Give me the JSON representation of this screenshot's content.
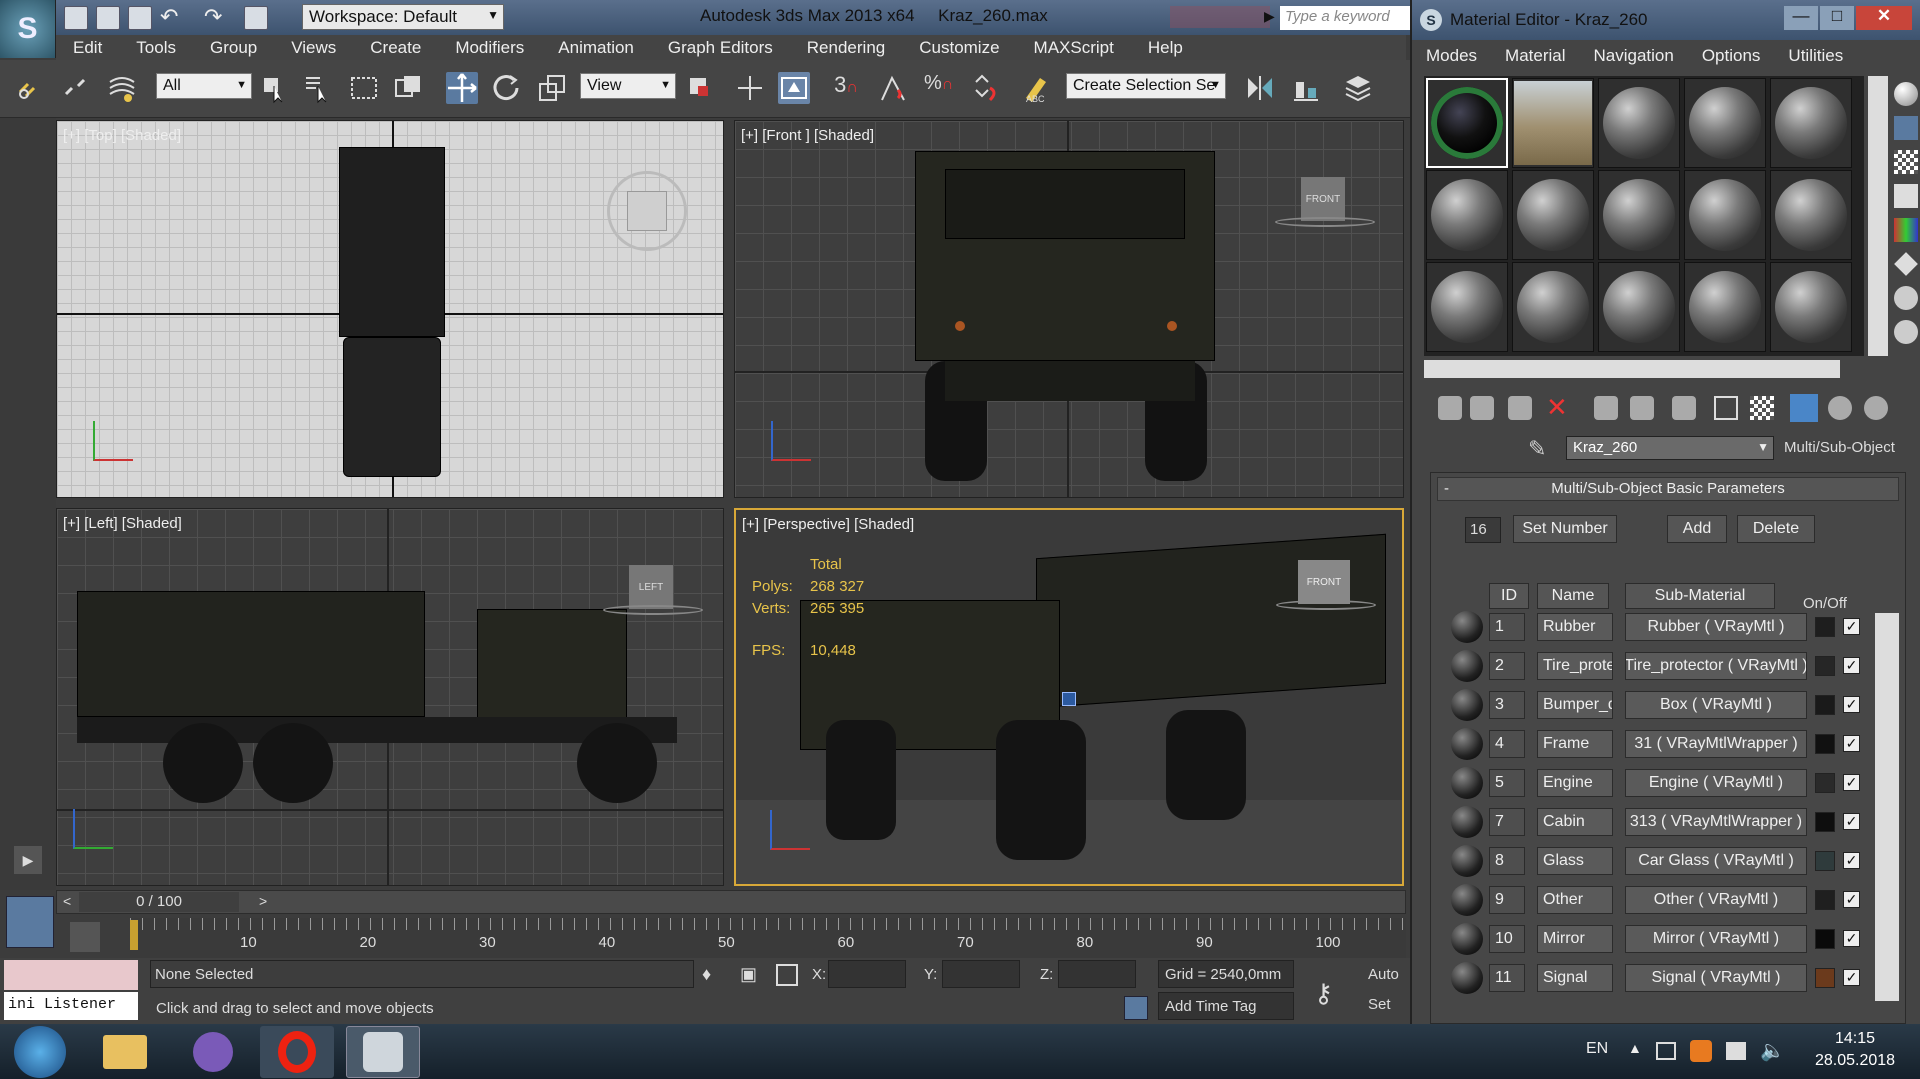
{
  "app": {
    "title": "Autodesk 3ds Max  2013 x64",
    "file": "Kraz_260.max",
    "logo": "S",
    "workspace": "Workspace: Default",
    "search_placeholder": "Type a keyword"
  },
  "menu": [
    "Edit",
    "Tools",
    "Group",
    "Views",
    "Create",
    "Modifiers",
    "Animation",
    "Graph Editors",
    "Rendering",
    "Customize",
    "MAXScript",
    "Help"
  ],
  "toolbar": {
    "filter": "All",
    "refcoord": "View",
    "selection_set": "Create Selection Se",
    "snap_toggle": "3"
  },
  "viewports": {
    "top": {
      "label": "[+] [Top] [Shaded]"
    },
    "front": {
      "label": "[+] [Front ] [Shaded]",
      "viewcube": "FRONT"
    },
    "left": {
      "label": "[+] [Left] [Shaded]",
      "viewcube": "LEFT"
    },
    "perspective": {
      "label": "[+] [Perspective] [Shaded]",
      "viewcube": "FRONT",
      "stats_title": "Total",
      "polys_label": "Polys:",
      "polys_value": "268 327",
      "verts_label": "Verts:",
      "verts_value": "265 395",
      "fps_label": "FPS:",
      "fps_value": "10,448"
    }
  },
  "timeline": {
    "frame": "0 / 100",
    "ticks": [
      "10",
      "20",
      "30",
      "40",
      "50",
      "60",
      "70",
      "80",
      "90",
      "100"
    ]
  },
  "status": {
    "selection": "None Selected",
    "prompt": "Click and drag to select and move objects",
    "listener": "ini Listener",
    "x_label": "X:",
    "y_label": "Y:",
    "z_label": "Z:",
    "grid": "Grid = 2540,0mm",
    "add_time_tag": "Add Time Tag",
    "auto": "Auto",
    "set": "Set"
  },
  "taskbar": {
    "lang": "EN",
    "time": "14:15",
    "date": "28.05.2018"
  },
  "material_editor": {
    "title": "Material Editor - Kraz_260",
    "menu": [
      "Modes",
      "Material",
      "Navigation",
      "Options",
      "Utilities"
    ],
    "material_name": "Kraz_260",
    "material_type": "Multi/Sub-Object",
    "rollout_title": "Multi/Sub-Object Basic Parameters",
    "rollout_toggle": "-",
    "count": "16",
    "set_number": "Set Number",
    "add": "Add",
    "delete": "Delete",
    "col_id": "ID",
    "col_name": "Name",
    "col_submaterial": "Sub-Material",
    "col_onoff": "On/Off",
    "rows": [
      {
        "id": "1",
        "name": "Rubber",
        "sub": "Rubber  ( VRayMtl )",
        "color": "#1e1e1e"
      },
      {
        "id": "2",
        "name": "Tire_prote",
        "sub": "Tire_protector  ( VRayMtl )",
        "color": "#262626"
      },
      {
        "id": "3",
        "name": "Bumper_di",
        "sub": "Box  ( VRayMtl )",
        "color": "#1a1a1a"
      },
      {
        "id": "4",
        "name": "Frame",
        "sub": "31  ( VRayMtlWrapper )",
        "color": "#111111"
      },
      {
        "id": "5",
        "name": "Engine",
        "sub": "Engine  ( VRayMtl )",
        "color": "#2a2a2a"
      },
      {
        "id": "7",
        "name": "Cabin",
        "sub": "313  ( VRayMtlWrapper )",
        "color": "#0e0e0e"
      },
      {
        "id": "8",
        "name": "Glass",
        "sub": "Car Glass  ( VRayMtl )",
        "color": "#2f3b3c"
      },
      {
        "id": "9",
        "name": "Other",
        "sub": "Other  ( VRayMtl )",
        "color": "#1f1f1f"
      },
      {
        "id": "10",
        "name": "Mirror",
        "sub": "Mirror  ( VRayMtl )",
        "color": "#0a0a0a"
      },
      {
        "id": "11",
        "name": "Signal",
        "sub": "Signal  ( VRayMtl )",
        "color": "#6b3a1c"
      }
    ]
  }
}
